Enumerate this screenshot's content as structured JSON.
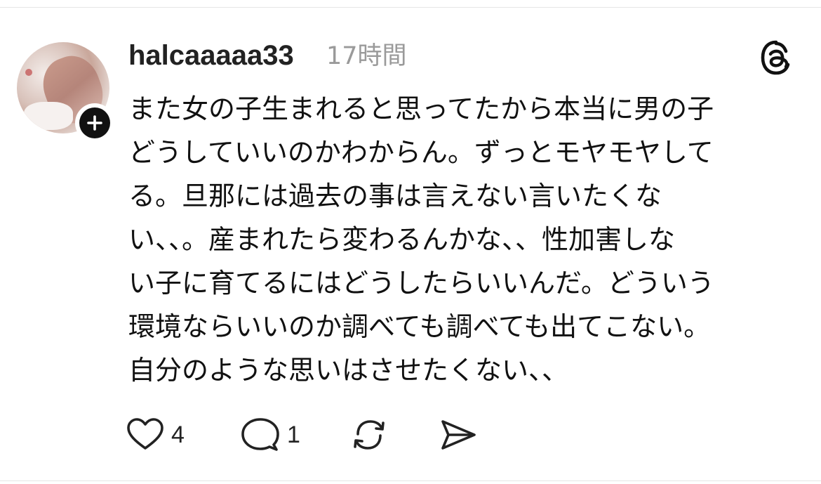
{
  "post": {
    "username": "halcaaaaa33",
    "time": "17時間",
    "text_lines": [
      "また女の子生まれると思ってたから本当に男の子",
      "どうしていいのかわからん。ずっとモヤモヤして",
      "る。旦那には過去の事は言えない言いたくな",
      "い、、。産まれたら変わるんかな、、性加害しな",
      "い子に育てるにはどうしたらいいんだ。どういう",
      "環境ならいいのか調べても調べても出てこない。",
      "自分のような思いはさせたくない、、"
    ]
  },
  "actions": {
    "like": {
      "icon": "heart-icon",
      "count": "4"
    },
    "reply": {
      "icon": "comment-icon",
      "count": "1"
    },
    "repost": {
      "icon": "repost-icon"
    },
    "share": {
      "icon": "send-icon"
    }
  },
  "colors": {
    "text": "#111111",
    "muted": "#9a9a9a",
    "icon": "#222222",
    "divider": "#e6e6e6"
  }
}
